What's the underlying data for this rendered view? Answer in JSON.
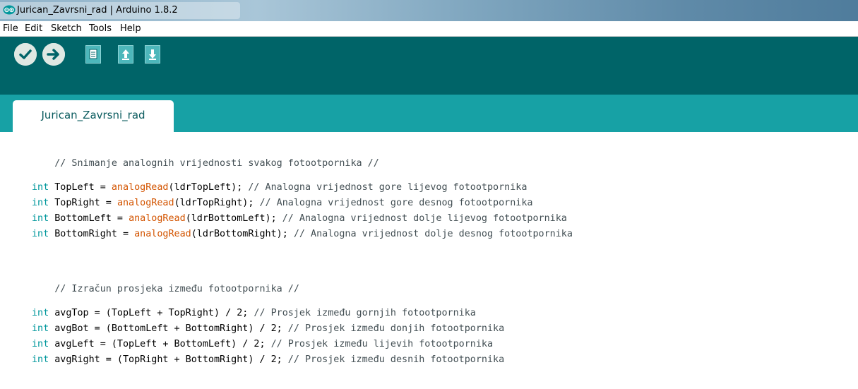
{
  "window": {
    "title": "Jurican_Zavrsni_rad | Arduino 1.8.2"
  },
  "menu": {
    "items": [
      "File",
      "Edit",
      "Sketch",
      "Tools",
      "Help"
    ]
  },
  "toolbar": {
    "buttons": [
      "verify-icon",
      "upload-icon",
      "new-icon",
      "open-icon",
      "save-icon"
    ],
    "colors": {
      "bar": "#006468",
      "tabs": "#17a1a5",
      "keyword": "#00979c",
      "function": "#d35400"
    }
  },
  "tabs": [
    {
      "label": "Jurican_Zavrsni_rad"
    }
  ],
  "code": {
    "line1": {
      "comment": "// Snimanje analognih vrijednosti svakog fotootpornika //"
    },
    "line2": {
      "kw": "int",
      "lhs": " TopLeft = ",
      "fn": "analogRead",
      "args": "(ldrTopLeft);",
      "comment": " // Analogna vrijednost gore lijevog fotootpornika"
    },
    "line3": {
      "kw": "int",
      "lhs": " TopRight = ",
      "fn": "analogRead",
      "args": "(ldrTopRight);",
      "comment": " // Analogna vrijednost gore desnog fotootpornika"
    },
    "line4": {
      "kw": "int",
      "lhs": " BottomLeft = ",
      "fn": "analogRead",
      "args": "(ldrBottomLeft);",
      "comment": " // Analogna vrijednost dolje lijevog fotootpornika"
    },
    "line5": {
      "kw": "int",
      "lhs": " BottomRight = ",
      "fn": "analogRead",
      "args": "(ldrBottomRight);",
      "comment": " // Analogna vrijednost dolje desnog fotootpornika"
    },
    "line6": {
      "comment": "// Izračun prosjeka između fotootpornika //"
    },
    "line7": {
      "kw": "int",
      "expr": " avgTop = (TopLeft + TopRight) / 2;",
      "comment": " // Prosjek između gornjih fotootpornika"
    },
    "line8": {
      "kw": "int",
      "expr": " avgBot = (BottomLeft + BottomRight) / 2;",
      "comment": " // Prosjek između donjih fotootpornika"
    },
    "line9": {
      "kw": "int",
      "expr": " avgLeft = (TopLeft + BottomLeft) / 2;",
      "comment": " // Prosjek između lijevih fotootpornika"
    },
    "line10": {
      "kw": "int",
      "expr": " avgRight = (TopRight + BottomRight) / 2;",
      "comment": " // Prosjek između desnih fotootpornika"
    }
  }
}
